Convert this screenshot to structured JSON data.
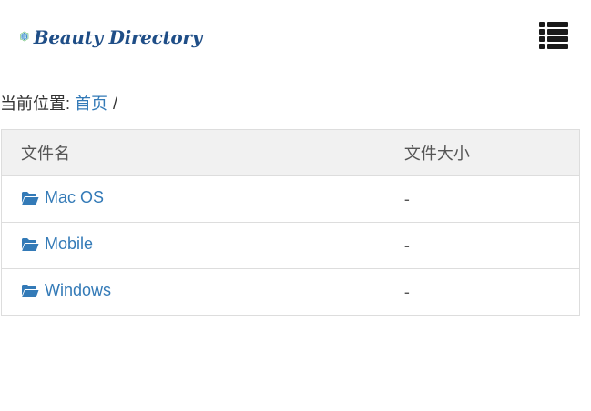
{
  "header": {
    "logo_text": "Beauty Directory",
    "brand_color": "#1f4e87",
    "menu_icon": "list-icon"
  },
  "breadcrumb": {
    "prefix": "当前位置:",
    "home_label": "首页",
    "separator": "/"
  },
  "table": {
    "columns": [
      "文件名",
      "文件大小"
    ],
    "rows": [
      {
        "name": "Mac OS",
        "size": "-",
        "icon": "folder-open-icon"
      },
      {
        "name": "Mobile",
        "size": "-",
        "icon": "folder-open-icon"
      },
      {
        "name": "Windows",
        "size": "-",
        "icon": "folder-open-icon"
      }
    ]
  },
  "colors": {
    "link": "#337ab7",
    "header_row_bg": "#f1f1f1",
    "border": "#dddddd"
  }
}
